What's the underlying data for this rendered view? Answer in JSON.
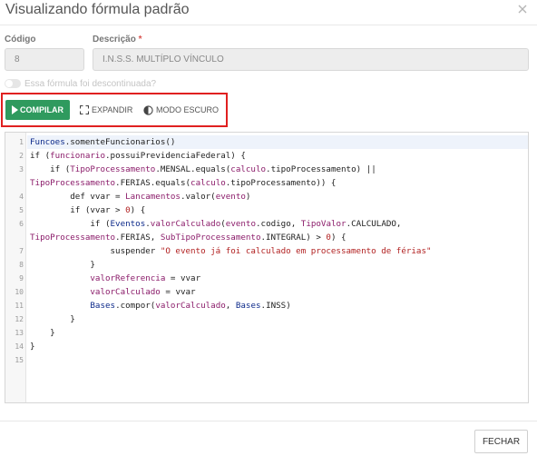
{
  "dialog": {
    "title": "Visualizando fórmula padrão",
    "close_icon": "close-icon"
  },
  "form": {
    "codigo_label": "Código",
    "codigo_value": "8",
    "descricao_label": "Descrição",
    "descricao_required": "*",
    "descricao_value": "I.N.S.S. MULTÍPLO VÍNCULO",
    "discontinued_label": "Essa fórmula foi descontinuada?",
    "discontinued_checked": false
  },
  "toolbar": {
    "compile_label": "COMPILAR",
    "expand_label": "EXPANDIR",
    "dark_mode_label": "MODO ESCURO",
    "compile_color": "#2f9a5e",
    "highlight_color": "#e02020"
  },
  "editor": {
    "line_numbers": [
      "1",
      "2",
      "3",
      "",
      "4",
      "5",
      "6",
      "",
      "7",
      "8",
      "9",
      "10",
      "11",
      "12",
      "13",
      "14",
      "15"
    ],
    "lines": [
      "Funcoes.somenteFuncionarios()",
      "if (funcionario.possuiPrevidenciaFederal) {",
      "    if (TipoProcessamento.MENSAL.equals(calculo.tipoProcessamento) ||",
      "TipoProcessamento.FERIAS.equals(calculo.tipoProcessamento)) {",
      "        def vvar = Lancamentos.valor(evento)",
      "        if (vvar > 0) {",
      "            if (Eventos.valorCalculado(evento.codigo, TipoValor.CALCULADO,",
      "TipoProcessamento.FERIAS, SubTipoProcessamento.INTEGRAL) > 0) {",
      "                suspender \"O evento já foi calculado em processamento de férias\"",
      "            }",
      "            valorReferencia = vvar",
      "            valorCalculado = vvar",
      "            Bases.compor(valorCalculado, Bases.INSS)",
      "        }",
      "    }",
      "}",
      ""
    ]
  },
  "footer": {
    "close_label": "FECHAR"
  }
}
